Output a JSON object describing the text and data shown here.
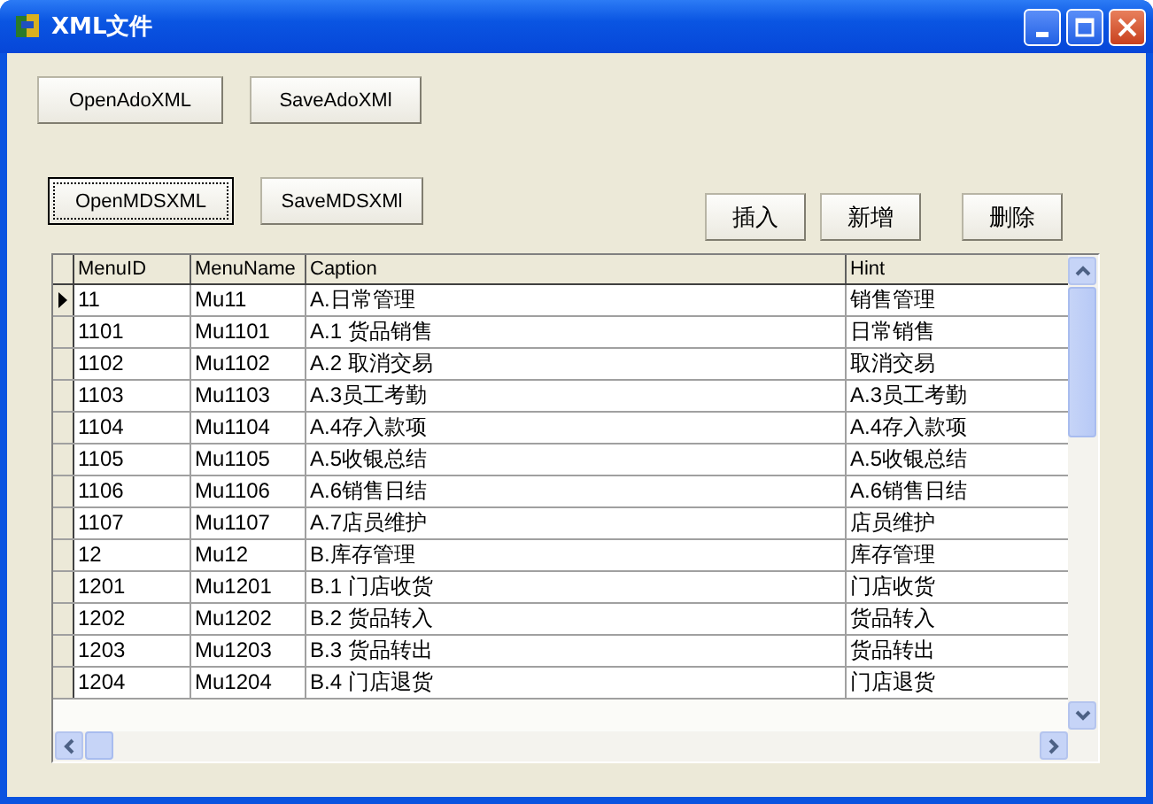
{
  "window": {
    "title": "XML文件"
  },
  "file_buttons": [
    {
      "label": "OpenAdoXML",
      "focused": false
    },
    {
      "label": "SaveAdoXMl",
      "focused": false
    }
  ],
  "mds_buttons": [
    {
      "label": "OpenMDSXML",
      "focused": true
    },
    {
      "label": "SaveMDSXMl",
      "focused": false
    }
  ],
  "action_buttons": [
    {
      "label": "插入"
    },
    {
      "label": "新增"
    },
    {
      "label": "删除"
    }
  ],
  "table": {
    "columns": [
      "MenuID",
      "MenuName",
      "Caption",
      "Hint"
    ],
    "rows": [
      {
        "current": true,
        "cells": [
          "11",
          "Mu11",
          "A.日常管理",
          "销售管理"
        ]
      },
      {
        "current": false,
        "cells": [
          "1101",
          "Mu1101",
          "A.1 货品销售",
          "日常销售"
        ]
      },
      {
        "current": false,
        "cells": [
          "1102",
          "Mu1102",
          "A.2 取消交易",
          "取消交易"
        ]
      },
      {
        "current": false,
        "cells": [
          "1103",
          "Mu1103",
          "A.3员工考勤",
          "A.3员工考勤"
        ]
      },
      {
        "current": false,
        "cells": [
          "1104",
          "Mu1104",
          "A.4存入款项",
          "A.4存入款项"
        ]
      },
      {
        "current": false,
        "cells": [
          "1105",
          "Mu1105",
          "A.5收银总结",
          "A.5收银总结"
        ]
      },
      {
        "current": false,
        "cells": [
          "1106",
          "Mu1106",
          "A.6销售日结",
          "A.6销售日结"
        ]
      },
      {
        "current": false,
        "cells": [
          "1107",
          "Mu1107",
          "A.7店员维护",
          "店员维护"
        ]
      },
      {
        "current": false,
        "cells": [
          "12",
          "Mu12",
          "B.库存管理",
          "库存管理"
        ]
      },
      {
        "current": false,
        "cells": [
          "1201",
          "Mu1201",
          "B.1 门店收货",
          "门店收货"
        ]
      },
      {
        "current": false,
        "cells": [
          "1202",
          "Mu1202",
          "B.2 货品转入",
          "货品转入"
        ]
      },
      {
        "current": false,
        "cells": [
          "1203",
          "Mu1203",
          "B.3 货品转出",
          "货品转出"
        ]
      },
      {
        "current": false,
        "cells": [
          "1204",
          "Mu1204",
          "B.4 门店退货",
          "门店退货"
        ]
      }
    ]
  }
}
